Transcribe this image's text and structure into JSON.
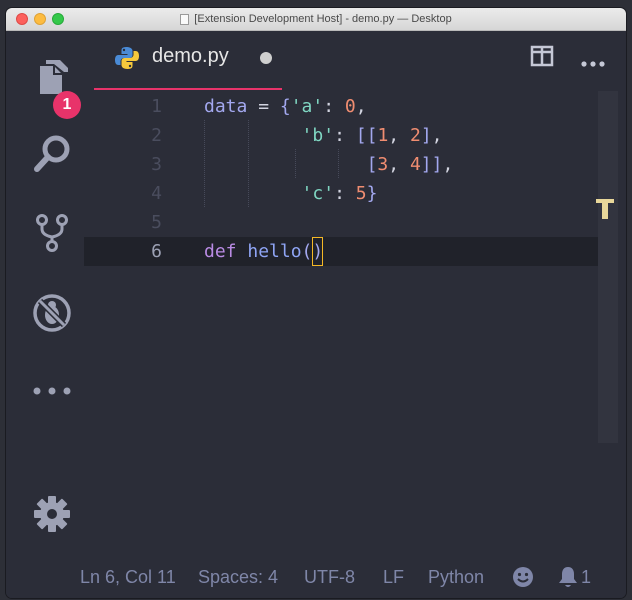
{
  "window": {
    "title": "[Extension Development Host] - demo.py — Desktop"
  },
  "activity_bar": {
    "items": [
      {
        "icon": "files-icon"
      },
      {
        "icon": "search-icon"
      },
      {
        "icon": "source-control-icon"
      },
      {
        "icon": "debug-disabled-icon"
      },
      {
        "icon": "more-icon"
      }
    ],
    "explorer_badge": "1",
    "manage_icon": "gear-icon"
  },
  "tab": {
    "label": "demo.py",
    "icon": "python-icon",
    "modified": true
  },
  "editor_actions": [
    "split-editor-icon",
    "more-actions-icon"
  ],
  "editor": {
    "line_numbers": [
      "1",
      "2",
      "3",
      "4",
      "5",
      "6"
    ],
    "current_line": 6,
    "lines": [
      [
        [
          "var",
          "data"
        ],
        [
          "op",
          " = "
        ],
        [
          "punc",
          "{"
        ],
        [
          "str",
          "'a'"
        ],
        [
          "op",
          ": "
        ],
        [
          "num",
          "0"
        ],
        [
          "op",
          ","
        ]
      ],
      [
        [
          "op",
          "         "
        ],
        [
          "str",
          "'b'"
        ],
        [
          "op",
          ": "
        ],
        [
          "punc",
          "[["
        ],
        [
          "num",
          "1"
        ],
        [
          "op",
          ", "
        ],
        [
          "num",
          "2"
        ],
        [
          "punc",
          "]"
        ],
        [
          "op",
          ","
        ]
      ],
      [
        [
          "op",
          "               "
        ],
        [
          "punc",
          "["
        ],
        [
          "num",
          "3"
        ],
        [
          "op",
          ", "
        ],
        [
          "num",
          "4"
        ],
        [
          "punc",
          "]]"
        ],
        [
          "op",
          ","
        ]
      ],
      [
        [
          "op",
          "         "
        ],
        [
          "str",
          "'c'"
        ],
        [
          "op",
          ": "
        ],
        [
          "num",
          "5"
        ],
        [
          "punc",
          "}"
        ]
      ],
      [],
      [
        [
          "def",
          "def"
        ],
        [
          "op",
          " "
        ],
        [
          "fn",
          "hello"
        ],
        [
          "punc",
          "("
        ],
        [
          "cursor",
          ")"
        ]
      ]
    ],
    "colors": {
      "variable": "#a3a8ef",
      "string": "#7fd6c2",
      "number": "#f08d71",
      "keyword": "#b98be4",
      "function": "#8fa5f5",
      "cursor": "#f5b826"
    }
  },
  "status_bar": {
    "position": "Ln 6, Col 11",
    "indent": "Spaces: 4",
    "encoding": "UTF-8",
    "eol": "LF",
    "language": "Python",
    "notifications_count": "1",
    "feedback_icon": "smiley-icon",
    "bell_icon": "bell-icon"
  },
  "theme": {
    "accent": "#e8336a",
    "background": "#2b2d38"
  }
}
